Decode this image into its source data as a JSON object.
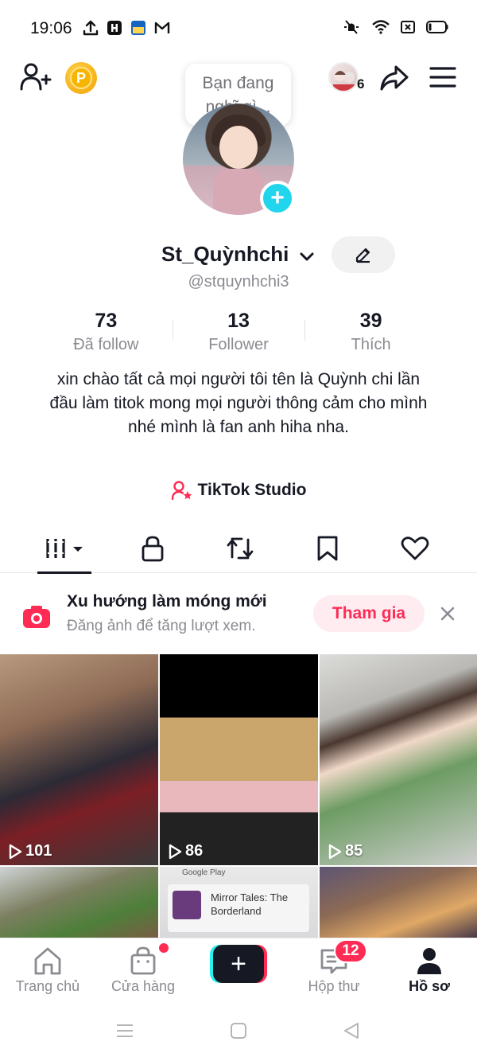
{
  "status_bar": {
    "time": "19:06",
    "left_icons": [
      "upload-icon",
      "hbo-icon",
      "app-notification-icon",
      "gmail-icon"
    ],
    "right_icons": [
      "silent-icon",
      "wifi-icon",
      "sim-icon",
      "battery-icon"
    ]
  },
  "header": {
    "thought_bubble": "Bạn đang nghĩ gì...",
    "friends_count": "6"
  },
  "profile": {
    "username": "St_Quỳnhchi",
    "handle": "@stquynhchi3",
    "stats": [
      {
        "value": "73",
        "label": "Đã follow"
      },
      {
        "value": "13",
        "label": "Follower"
      },
      {
        "value": "39",
        "label": "Thích"
      }
    ],
    "bio": "xin chào tất cả mọi người tôi tên là Quỳnh chi lần đầu làm titok mong mọi người thông cảm cho mình nhé mình là fan anh hiha nha.",
    "studio_label": "TikTok Studio"
  },
  "tabs": [
    "videos-tab",
    "private-tab",
    "reposts-tab",
    "favorites-tab",
    "liked-tab"
  ],
  "banner": {
    "title": "Xu hướng làm móng mới",
    "subtitle": "Đăng ảnh để tăng lượt xem.",
    "join_label": "Tham gia"
  },
  "videos": [
    {
      "views": "101"
    },
    {
      "views": "86"
    },
    {
      "views": "85"
    },
    {
      "views": ""
    },
    {
      "views": "",
      "ad_source": "Google Play",
      "ad_title": "Mirror Tales: The Borderland"
    },
    {
      "views": ""
    }
  ],
  "bottom_nav": {
    "items": [
      {
        "label": "Trang chủ"
      },
      {
        "label": "Cửa hàng"
      },
      {
        "label": ""
      },
      {
        "label": "Hộp thư"
      },
      {
        "label": "Hồ sơ"
      }
    ],
    "inbox_badge": "12"
  },
  "colors": {
    "accent": "#fe2c55",
    "cyan": "#25f4ee",
    "text": "#161823",
    "muted": "#8a8b91"
  }
}
